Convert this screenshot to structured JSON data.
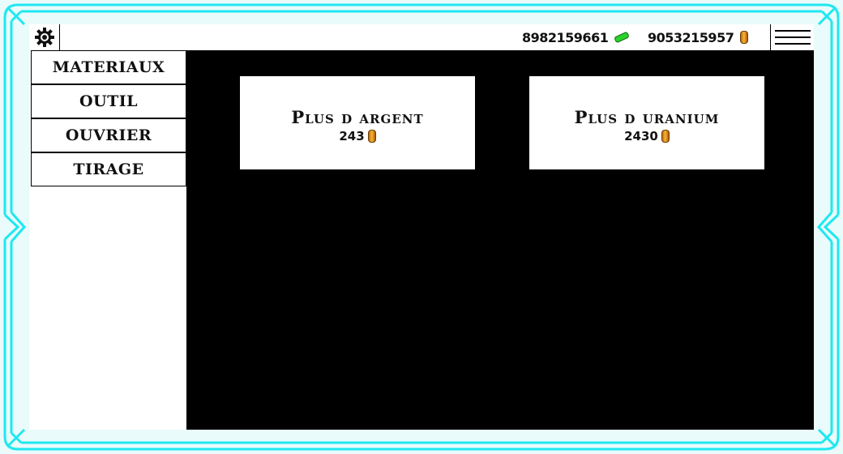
{
  "theme": {
    "frame_color": "#1ee8f0",
    "background": "#e9fbfb",
    "panel": "#000000"
  },
  "topbar": {
    "settings_icon": "gear-icon",
    "uranium": {
      "value": "8982159661",
      "icon": "uranium-pill-icon"
    },
    "gold": {
      "value": "9053215957",
      "icon": "gold-coin-icon"
    },
    "menu_icon": "hamburger-menu-icon"
  },
  "sidebar": {
    "items": [
      {
        "label": "MATERIAUX"
      },
      {
        "label": "OUTIL"
      },
      {
        "label": "OUVRIER"
      },
      {
        "label": "TIRAGE"
      }
    ]
  },
  "shop": {
    "cards": [
      {
        "title": "Plus d argent",
        "price": "243",
        "currency_icon": "gold-coin-icon"
      },
      {
        "title": "Plus d uranium",
        "price": "2430",
        "currency_icon": "gold-coin-icon"
      }
    ]
  }
}
